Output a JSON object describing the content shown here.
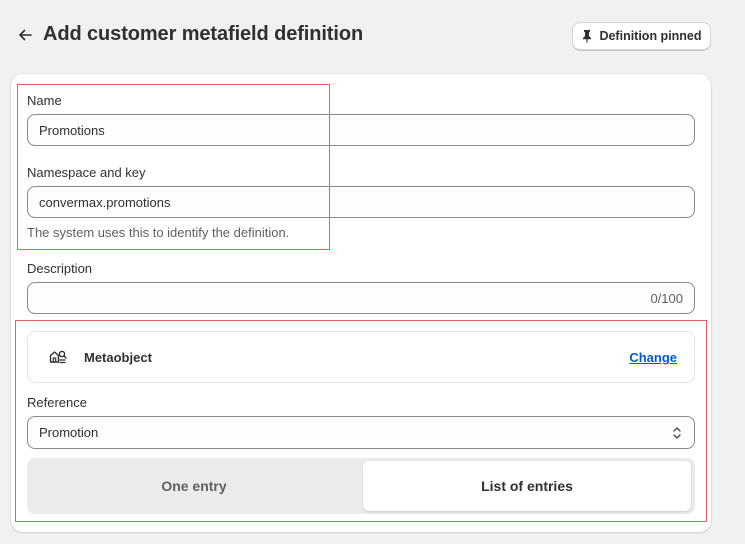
{
  "header": {
    "title": "Add customer metafield definition",
    "pin_button_label": "Definition pinned"
  },
  "form": {
    "name": {
      "label": "Name",
      "value": "Promotions"
    },
    "namespace": {
      "label": "Namespace and key",
      "value": "convermax.promotions",
      "help": "The system uses this to identify the definition."
    },
    "description": {
      "label": "Description",
      "value": "",
      "counter": "0/100"
    },
    "type": {
      "title": "Metaobject",
      "change_label": "Change"
    },
    "reference": {
      "label": "Reference",
      "value": "Promotion"
    },
    "entries": {
      "options": [
        "One entry",
        "List of entries"
      ],
      "selected": "List of entries"
    }
  },
  "colors": {
    "highlight_box": "#e0605e",
    "link": "#005bd3"
  }
}
